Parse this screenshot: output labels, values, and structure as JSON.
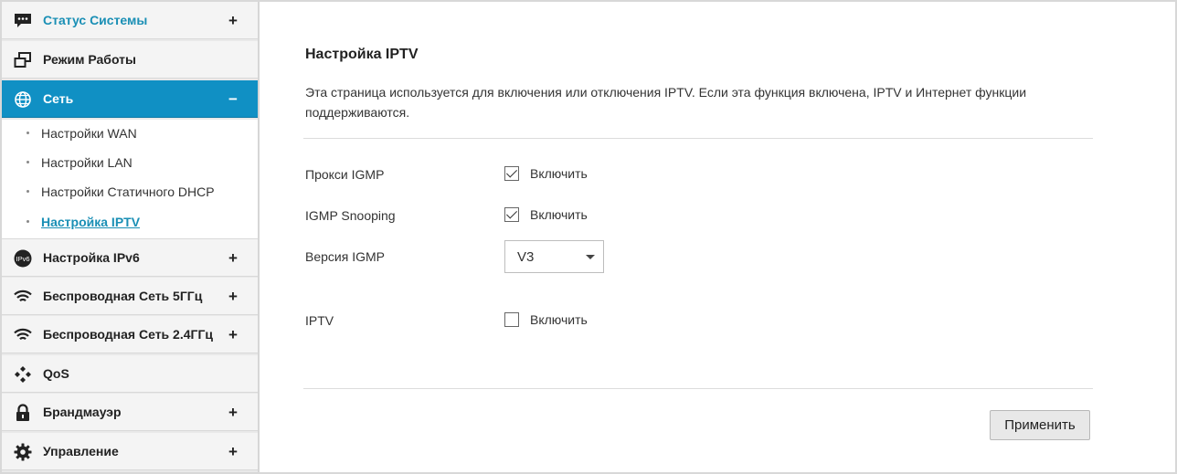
{
  "sidebar": {
    "items": [
      {
        "label": "Статус Системы",
        "toggle": "+",
        "icon": "chat-bubble-icon"
      },
      {
        "label": "Режим Работы",
        "toggle": "",
        "icon": "windows-icon"
      },
      {
        "label": "Сеть",
        "toggle": "−",
        "icon": "globe-icon"
      },
      {
        "label": "Настройка IPv6",
        "toggle": "+",
        "icon": "ipv6-icon",
        "icon_text": "IPv6"
      },
      {
        "label": "Беспроводная Сеть 5ГГц",
        "toggle": "+",
        "icon": "wifi-icon"
      },
      {
        "label": "Беспроводная Сеть 2.4ГГц",
        "toggle": "+",
        "icon": "wifi-icon"
      },
      {
        "label": "QoS",
        "toggle": "",
        "icon": "qos-icon"
      },
      {
        "label": "Брандмауэр",
        "toggle": "+",
        "icon": "lock-icon"
      },
      {
        "label": "Управление",
        "toggle": "+",
        "icon": "gear-icon"
      }
    ],
    "network_submenu": [
      {
        "label": "Настройки WAN"
      },
      {
        "label": "Настройки LAN"
      },
      {
        "label": "Настройки Статичного DHCP"
      },
      {
        "label": "Настройка IPTV",
        "current": true
      }
    ]
  },
  "main": {
    "title": "Настройка IPTV",
    "description": "Эта страница используется для включения или отключения IPTV. Если эта функция включена, IPTV и Интернет функции поддерживаются.",
    "fields": {
      "igmp_proxy": {
        "label": "Прокси IGMP",
        "checked": true,
        "check_label": "Включить"
      },
      "igmp_snooping": {
        "label": "IGMP Snooping",
        "checked": true,
        "check_label": "Включить"
      },
      "igmp_version": {
        "label": "Версия IGMP",
        "value": "V3"
      },
      "iptv": {
        "label": "IPTV",
        "checked": false,
        "check_label": "Включить"
      }
    },
    "apply_label": "Применить"
  },
  "colors": {
    "accent": "#1090c4",
    "link": "#1a8fb5",
    "sidebar_bg": "#f4f4f4"
  }
}
